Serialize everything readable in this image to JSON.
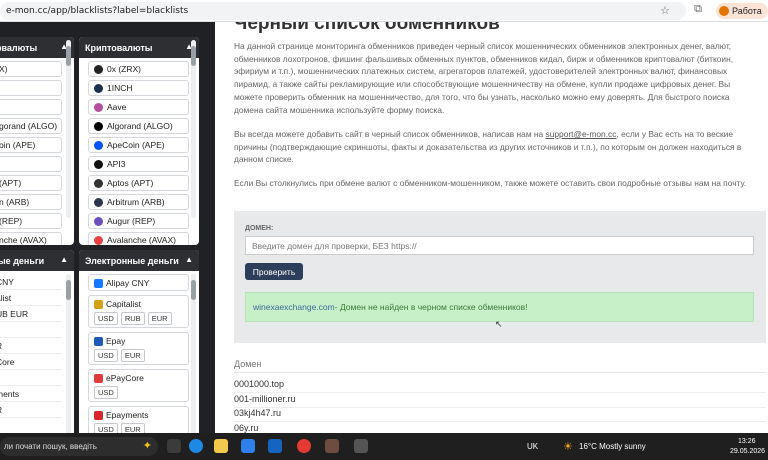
{
  "browser": {
    "url": "e-mon.cc/app/blacklists?label=blacklists",
    "profile_label": "Работа"
  },
  "crypto_panel": {
    "title": "Криптовалюты",
    "items": [
      {
        "label": "0x (ZRX)",
        "icon": "0x-icon",
        "color": "#222222"
      },
      {
        "label": "1INCH",
        "icon": "1inch-icon",
        "color": "#1b314f"
      },
      {
        "label": "Aave",
        "icon": "aave-icon",
        "color": "#b6509e"
      },
      {
        "label": "Algorand (ALGO)",
        "icon": "algorand-icon",
        "color": "#000000"
      },
      {
        "label": "ApeCoin (APE)",
        "icon": "apecoin-icon",
        "color": "#0054f9"
      },
      {
        "label": "API3",
        "icon": "api3-icon",
        "color": "#111111"
      },
      {
        "label": "Aptos (APT)",
        "icon": "aptos-icon",
        "color": "#333333"
      },
      {
        "label": "Arbitrum (ARB)",
        "icon": "arbitrum-icon",
        "color": "#2d374b"
      },
      {
        "label": "Augur (REP)",
        "icon": "augur-icon",
        "color": "#6b4fbb"
      },
      {
        "label": "Avalanche (AVAX)",
        "icon": "avalanche-icon",
        "color": "#e84142"
      }
    ]
  },
  "left_crypto_partial": [
    "X)",
    "",
    "",
    "gorand (ALGO)",
    "oin (APE)",
    "",
    "(APT)",
    "n (ARB)",
    "(REP)",
    "nche (AVAX)"
  ],
  "emoney_panel": {
    "title": "Электронные деньги",
    "items": [
      {
        "label": "Alipay CNY",
        "icon": "alipay-icon",
        "color": "#1677ff",
        "currencies": []
      },
      {
        "label": "Capitalist",
        "icon": "capitalist-icon",
        "color": "#d4a017",
        "currencies": [
          "USD",
          "RUB",
          "EUR"
        ]
      },
      {
        "label": "Epay",
        "icon": "epay-icon",
        "color": "#1e5bb8",
        "currencies": [
          "USD",
          "EUR"
        ]
      },
      {
        "label": "ePayCore",
        "icon": "epaycore-icon",
        "color": "#e03a3a",
        "currencies": [
          "USD"
        ]
      },
      {
        "label": "Epayments",
        "icon": "epayments-icon",
        "color": "#d9262c",
        "currencies": [
          "USD",
          "EUR"
        ]
      }
    ]
  },
  "left_emoney_partial": {
    "title": "ые деньги",
    "rows": [
      "CNY",
      "alist",
      "UB  EUR",
      "",
      "R",
      "Core",
      "",
      "ments",
      "R"
    ]
  },
  "main": {
    "title": "Черный список обменников",
    "paragraph1": "На данной странице мониторинга обменников приведен черный список мошеннических обменников электронных денег, валют, обменников лохотронов, фишинг фальшивых обменных пунктов, обменников кидал, бирж и обменников криптовалют (биткоин, эфириум и т.п.), мошеннических платежных систем, агрегаторов платежей, удостоверителей электронных валют, финансовых пирамид, а также сайты рекламирующие или способствующие мошенничеству на обмене, купли продаже цифровых денег. Вы можете проверить обменник на мошенничество, для того, что бы узнать, насколько можно ему доверять. Для быстрого поиска домена сайта мошенника используйте форму поиска.",
    "paragraph2_before": "Вы всегда можете добавить сайт в черный список обменников, написав нам на ",
    "paragraph2_link": "support@e-mon.cc",
    "paragraph2_after": ", если у Вас есть на то веские причины (подтверждающие скриншоты, факты и доказательства из других источников и т.п.), по которым он должен находиться в данном списке.",
    "paragraph3": "Если Вы столкнулись при обмене валют с обменником-мошенником, также можете оставить свои подробные отзывы нам на почту.",
    "form": {
      "label": "Домен:",
      "placeholder": "Введите домен для проверки, БЕЗ https://",
      "button": "Проверить",
      "result_domain": "winexaexchange.com",
      "result_text": " - Домен не найден в черном списке обменников!"
    },
    "table_header": "Домен",
    "domains": [
      "0001000.top",
      "001-millioner.ru",
      "03kj4h47.ru",
      "06y.ru"
    ]
  },
  "taskbar": {
    "search_text": "ли почати пошук, введіть",
    "weather": "16°C  Mostly sunny",
    "lang": "UK",
    "time": "13:26",
    "date": "29.05.2026"
  }
}
